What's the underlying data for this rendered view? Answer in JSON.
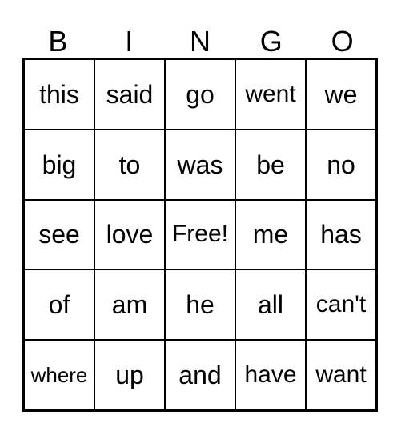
{
  "card": {
    "title": "BINGO",
    "text_color": "#000000",
    "background_color": "#ffffff",
    "border_color": "#000000",
    "headers": [
      "B",
      "I",
      "N",
      "G",
      "O"
    ],
    "free_space_label": "Free!",
    "free_space_position": {
      "row": 2,
      "column": 2
    },
    "rows": [
      [
        "this",
        "said",
        "go",
        "went",
        "we"
      ],
      [
        "big",
        "to",
        "was",
        "be",
        "no"
      ],
      [
        "see",
        "love",
        "Free!",
        "me",
        "has"
      ],
      [
        "of",
        "am",
        "he",
        "all",
        "can't"
      ],
      [
        "where",
        "up",
        "and",
        "have",
        "want"
      ]
    ]
  }
}
